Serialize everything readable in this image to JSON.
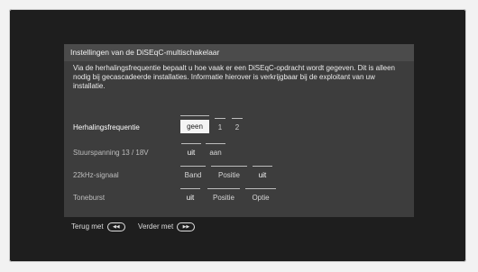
{
  "dialog": {
    "title": "Instellingen van de DiSEqC-multischakelaar",
    "description": "Via de herhalingsfrequentie bepaalt u hoe vaak er een DiSEqC-opdracht wordt gegeven. Dit is alleen nodig bij gecascadeerde installaties. Informatie hierover is verkrijgbaar bij de exploitant van uw installatie."
  },
  "rows": [
    {
      "label": "Herhalingsfrequentie",
      "options": [
        "geen",
        "1",
        "2"
      ]
    },
    {
      "label": "Stuurspanning 13 / 18V",
      "options": [
        "uit",
        "aan"
      ]
    },
    {
      "label": "22kHz-signaal",
      "options": [
        "Band",
        "Positie",
        "uit"
      ]
    },
    {
      "label": "Toneburst",
      "options": [
        "uit",
        "Positie",
        "Optie"
      ]
    }
  ],
  "footer": {
    "back_label": "Terug met",
    "back_icon": "rewind-icon",
    "next_label": "Verder met",
    "next_icon": "fast-forward-icon"
  }
}
